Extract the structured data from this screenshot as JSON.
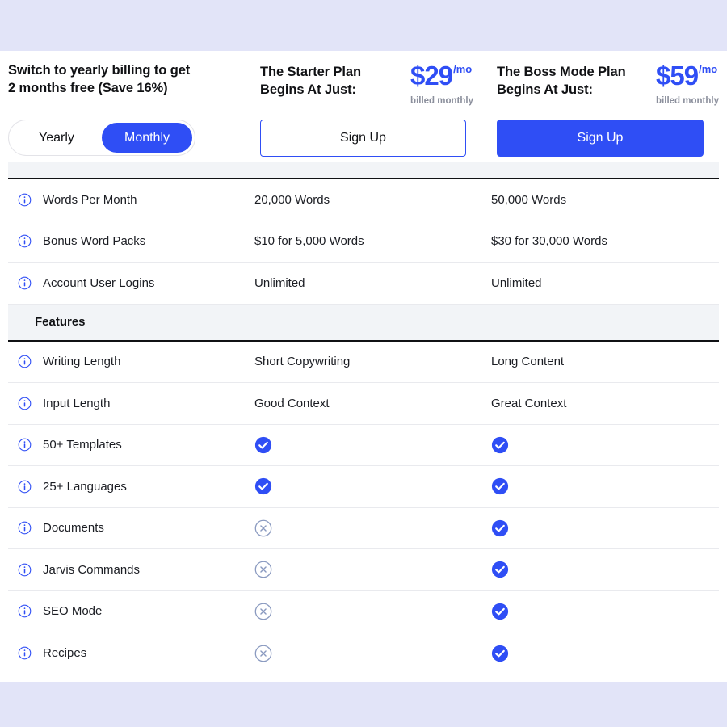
{
  "colors": {
    "page_background": "#e2e4f8",
    "card_background": "#ffffff",
    "accent_blue": "#2f4ef5",
    "section_gray": "#f2f4f7",
    "muted_text": "#8b8f9c",
    "cross_icon": "#8a9ac0"
  },
  "billing": {
    "headline_line1": "Switch to yearly billing to get",
    "headline_line2": "2 months free (Save 16%)",
    "toggle": {
      "options": [
        {
          "label": "Yearly",
          "selected": false
        },
        {
          "label": "Monthly",
          "selected": true
        }
      ],
      "selected": "Monthly"
    }
  },
  "plans": [
    {
      "name_line1": "The Starter Plan",
      "name_line2": "Begins At Just:",
      "price": "$29",
      "period": "/mo",
      "billing_note": "billed monthly",
      "cta_label": "Sign Up",
      "cta_style": "outline"
    },
    {
      "name_line1": "The Boss Mode Plan",
      "name_line2": "Begins At Just:",
      "price": "$59",
      "period": "/mo",
      "billing_note": "billed monthly",
      "cta_label": "Sign Up",
      "cta_style": "solid"
    }
  ],
  "table": {
    "rows": [
      {
        "type": "feature",
        "info_icon": "info-icon",
        "label": "Words Per Month",
        "starter": {
          "kind": "text",
          "value": "20,000 Words"
        },
        "boss": {
          "kind": "text",
          "value": "50,000 Words"
        }
      },
      {
        "type": "feature",
        "info_icon": "info-icon",
        "label": "Bonus Word Packs",
        "starter": {
          "kind": "text",
          "value": "$10 for 5,000 Words"
        },
        "boss": {
          "kind": "text",
          "value": "$30 for 30,000 Words"
        }
      },
      {
        "type": "feature",
        "info_icon": "info-icon",
        "label": "Account User Logins",
        "starter": {
          "kind": "text",
          "value": "Unlimited"
        },
        "boss": {
          "kind": "text",
          "value": "Unlimited"
        }
      },
      {
        "type": "section",
        "label": "Features"
      },
      {
        "type": "feature",
        "info_icon": "info-icon",
        "label": "Writing Length",
        "starter": {
          "kind": "text",
          "value": "Short Copywriting"
        },
        "boss": {
          "kind": "text",
          "value": "Long Content"
        }
      },
      {
        "type": "feature",
        "info_icon": "info-icon",
        "label": "Input Length",
        "starter": {
          "kind": "text",
          "value": "Good Context"
        },
        "boss": {
          "kind": "text",
          "value": "Great Context"
        }
      },
      {
        "type": "feature",
        "info_icon": "info-icon",
        "label": "50+ Templates",
        "starter": {
          "kind": "icon",
          "value": "check-icon"
        },
        "boss": {
          "kind": "icon",
          "value": "check-icon"
        }
      },
      {
        "type": "feature",
        "info_icon": "info-icon",
        "label": "25+ Languages",
        "starter": {
          "kind": "icon",
          "value": "check-icon"
        },
        "boss": {
          "kind": "icon",
          "value": "check-icon"
        }
      },
      {
        "type": "feature",
        "info_icon": "info-icon",
        "label": "Documents",
        "starter": {
          "kind": "icon",
          "value": "cross-icon"
        },
        "boss": {
          "kind": "icon",
          "value": "check-icon"
        }
      },
      {
        "type": "feature",
        "info_icon": "info-icon",
        "label": "Jarvis Commands",
        "starter": {
          "kind": "icon",
          "value": "cross-icon"
        },
        "boss": {
          "kind": "icon",
          "value": "check-icon"
        }
      },
      {
        "type": "feature",
        "info_icon": "info-icon",
        "label": "SEO Mode",
        "starter": {
          "kind": "icon",
          "value": "cross-icon"
        },
        "boss": {
          "kind": "icon",
          "value": "check-icon"
        }
      },
      {
        "type": "feature",
        "info_icon": "info-icon",
        "label": "Recipes",
        "starter": {
          "kind": "icon",
          "value": "cross-icon"
        },
        "boss": {
          "kind": "icon",
          "value": "check-icon"
        }
      }
    ]
  }
}
